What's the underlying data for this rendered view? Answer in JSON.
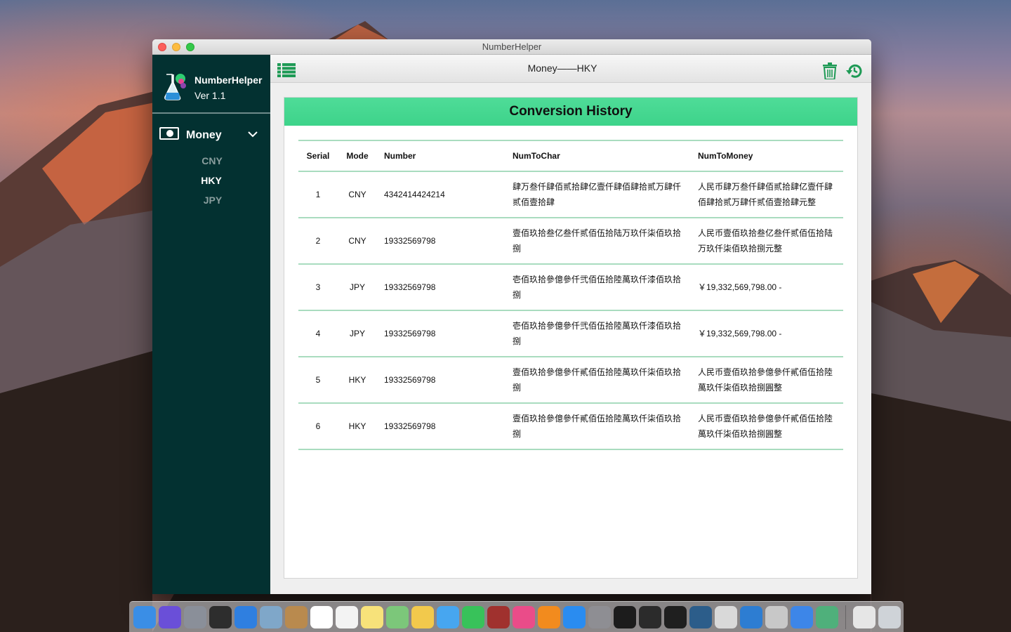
{
  "window": {
    "title": "NumberHelper"
  },
  "sidebar": {
    "app_name": "NumberHelper",
    "version": "Ver 1.1",
    "menu_label": "Money",
    "items": [
      {
        "label": "CNY",
        "active": false
      },
      {
        "label": "HKY",
        "active": true
      },
      {
        "label": "JPY",
        "active": false
      }
    ]
  },
  "toolbar": {
    "title": "Money——HKY"
  },
  "history": {
    "title": "Conversion History",
    "columns": [
      "Serial",
      "Mode",
      "Number",
      "NumToChar",
      "NumToMoney"
    ],
    "rows": [
      {
        "serial": "1",
        "mode": "CNY",
        "number": "4342414424214",
        "num_to_char": "肆万叁仟肆佰贰拾肆亿壹仟肆佰肆拾贰万肆仟贰佰壹拾肆",
        "num_to_money": "人民币肆万叁仟肆佰贰拾肆亿壹仟肆佰肆拾贰万肆仟贰佰壹拾肆元整"
      },
      {
        "serial": "2",
        "mode": "CNY",
        "number": "19332569798",
        "num_to_char": "壹佰玖拾叁亿叁仟贰佰伍拾陆万玖仟柒佰玖拾捌",
        "num_to_money": "人民币壹佰玖拾叁亿叁仟贰佰伍拾陆万玖仟柒佰玖拾捌元整"
      },
      {
        "serial": "3",
        "mode": "JPY",
        "number": "19332569798",
        "num_to_char": "壱佰玖拾參億參仟弐佰伍拾陸萬玖仟漆佰玖拾捌",
        "num_to_money": "￥19,332,569,798.00 -"
      },
      {
        "serial": "4",
        "mode": "JPY",
        "number": "19332569798",
        "num_to_char": "壱佰玖拾參億參仟弐佰伍拾陸萬玖仟漆佰玖拾捌",
        "num_to_money": "￥19,332,569,798.00 -"
      },
      {
        "serial": "5",
        "mode": "HKY",
        "number": "19332569798",
        "num_to_char": "壹佰玖拾參億參仟貳佰伍拾陸萬玖仟柒佰玖拾捌",
        "num_to_money": "人民币壹佰玖拾參億參仟貳佰伍拾陸萬玖仟柒佰玖拾捌圓整"
      },
      {
        "serial": "6",
        "mode": "HKY",
        "number": "19332569798",
        "num_to_char": "壹佰玖拾參億參仟貳佰伍拾陸萬玖仟柒佰玖拾捌",
        "num_to_money": "人民币壹佰玖拾參億參仟貳佰伍拾陸萬玖仟柒佰玖拾捌圓整"
      }
    ]
  },
  "colors": {
    "accent": "#3dd38a",
    "sidebar_bg": "#033131",
    "icon_green": "#1e9a55"
  },
  "dock": {
    "items": [
      "finder-icon",
      "siri-icon",
      "launchpad-icon",
      "mission-control-icon",
      "safari-icon",
      "preview-icon",
      "contacts-icon",
      "calendar-icon",
      "reminders-icon",
      "notes-icon",
      "maps-icon",
      "photos-icon",
      "messages-icon",
      "facetime-icon",
      "photo-booth-icon",
      "itunes-icon",
      "ibooks-icon",
      "app-store-icon",
      "system-preferences-icon",
      "terminal-icon",
      "console-icon",
      "activity-monitor-icon",
      "sourcetree-icon",
      "chrome-icon",
      "vscode-icon",
      "image-capture-icon",
      "xcode-icon",
      "numberhelper-icon",
      "documents-icon",
      "trash-icon"
    ]
  }
}
